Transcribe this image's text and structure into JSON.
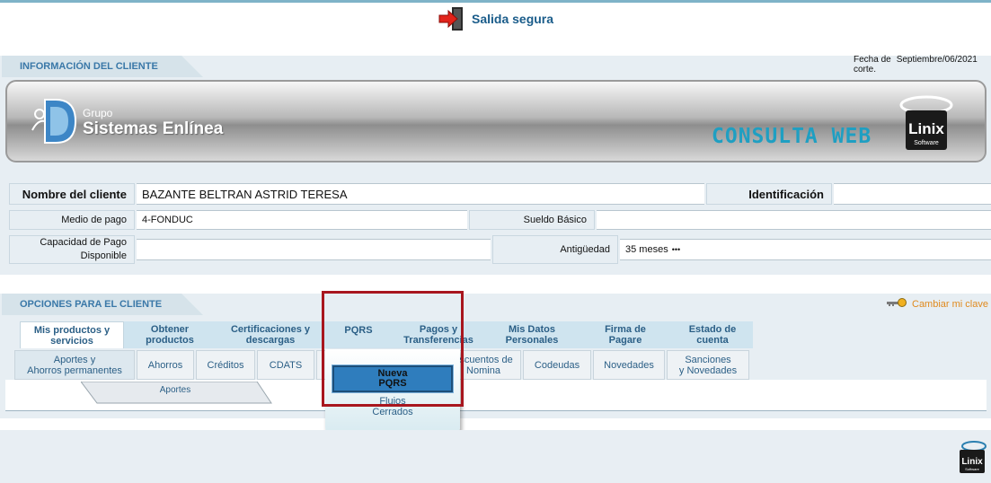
{
  "header": {
    "exit_label": "Salida segura"
  },
  "client_section": {
    "title": "INFORMACIÓN DEL CLIENTE"
  },
  "fecha": {
    "label_line1": "Fecha de",
    "label_line2": "corte.",
    "value": "Septiembre/06/2021"
  },
  "banner": {
    "grupo": "Grupo",
    "sistemas": "Sistemas Enlínea",
    "consulta": "CONSULTA WEB",
    "linix": "Linix",
    "linix_sub": "Software"
  },
  "client": {
    "name_label": "Nombre del cliente",
    "name_value": "BAZANTE BELTRAN ASTRID TERESA",
    "id_label": "Identificación",
    "id_value": "",
    "medio_label": "Medio de pago",
    "medio_value": "4-FONDUC",
    "sueldo_label": "Sueldo Básico",
    "sueldo_value": "",
    "capacidad_label_line1": "Capacidad de Pago",
    "capacidad_label_line2": "Disponible",
    "capacidad_value": "",
    "antiguedad_label": "Antigüedad",
    "antiguedad_value": "35 meses",
    "antiguedad_suffix": "•••"
  },
  "options_section": {
    "title": "OPCIONES PARA EL CLIENTE",
    "change_key": "Cambiar mi clave"
  },
  "main_tabs": [
    {
      "line1": "Mis productos y",
      "line2": "servicios"
    },
    {
      "line1": "Obtener",
      "line2": "productos"
    },
    {
      "line1": "Certificaciones y",
      "line2": "descargas"
    },
    {
      "line1": "PQRS",
      "line2": ""
    },
    {
      "line1": "Pagos y",
      "line2": "Transferencias"
    },
    {
      "line1": "Mis Datos",
      "line2": "Personales"
    },
    {
      "line1": "Firma de",
      "line2": "Pagare"
    },
    {
      "line1": "Estado de",
      "line2": "cuenta"
    }
  ],
  "sub_tabs": [
    {
      "line1": "Aportes y",
      "line2": "Ahorros permanentes"
    },
    {
      "line1": "Ahorros",
      "line2": ""
    },
    {
      "line1": "Créditos",
      "line2": ""
    },
    {
      "line1": "CDATS",
      "line2": ""
    },
    {
      "line1": "",
      "line2": ""
    },
    {
      "line1": "escuentos de",
      "line2": "Nomina"
    },
    {
      "line1": "Codeudas",
      "line2": ""
    },
    {
      "line1": "Novedades",
      "line2": ""
    },
    {
      "line1": "Sanciones",
      "line2": "y Novedades"
    }
  ],
  "third_tab": "Aportes",
  "pqrs_menu": {
    "nueva_line1": "Nueva",
    "nueva_line2": "PQRS",
    "flujos_line1": "Flujos",
    "flujos_line2": "Cerrados"
  }
}
